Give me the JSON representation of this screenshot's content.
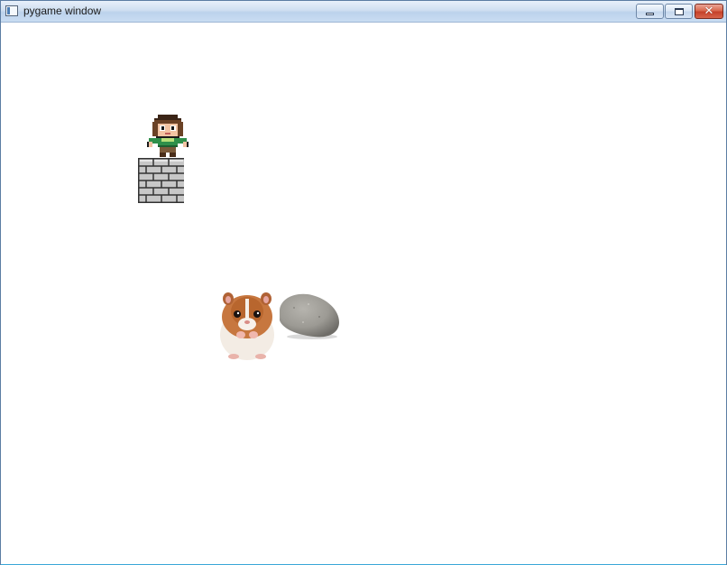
{
  "window": {
    "title": "pygame window"
  },
  "caption_buttons": {
    "minimize_icon": "minimize-icon",
    "maximize_icon": "maximize-icon",
    "close_icon": "close-icon",
    "close_glyph": "✕"
  },
  "scene": {
    "background_color": "#ffffff",
    "sprites": [
      "player-character",
      "brick-block",
      "hamster",
      "rock"
    ]
  }
}
